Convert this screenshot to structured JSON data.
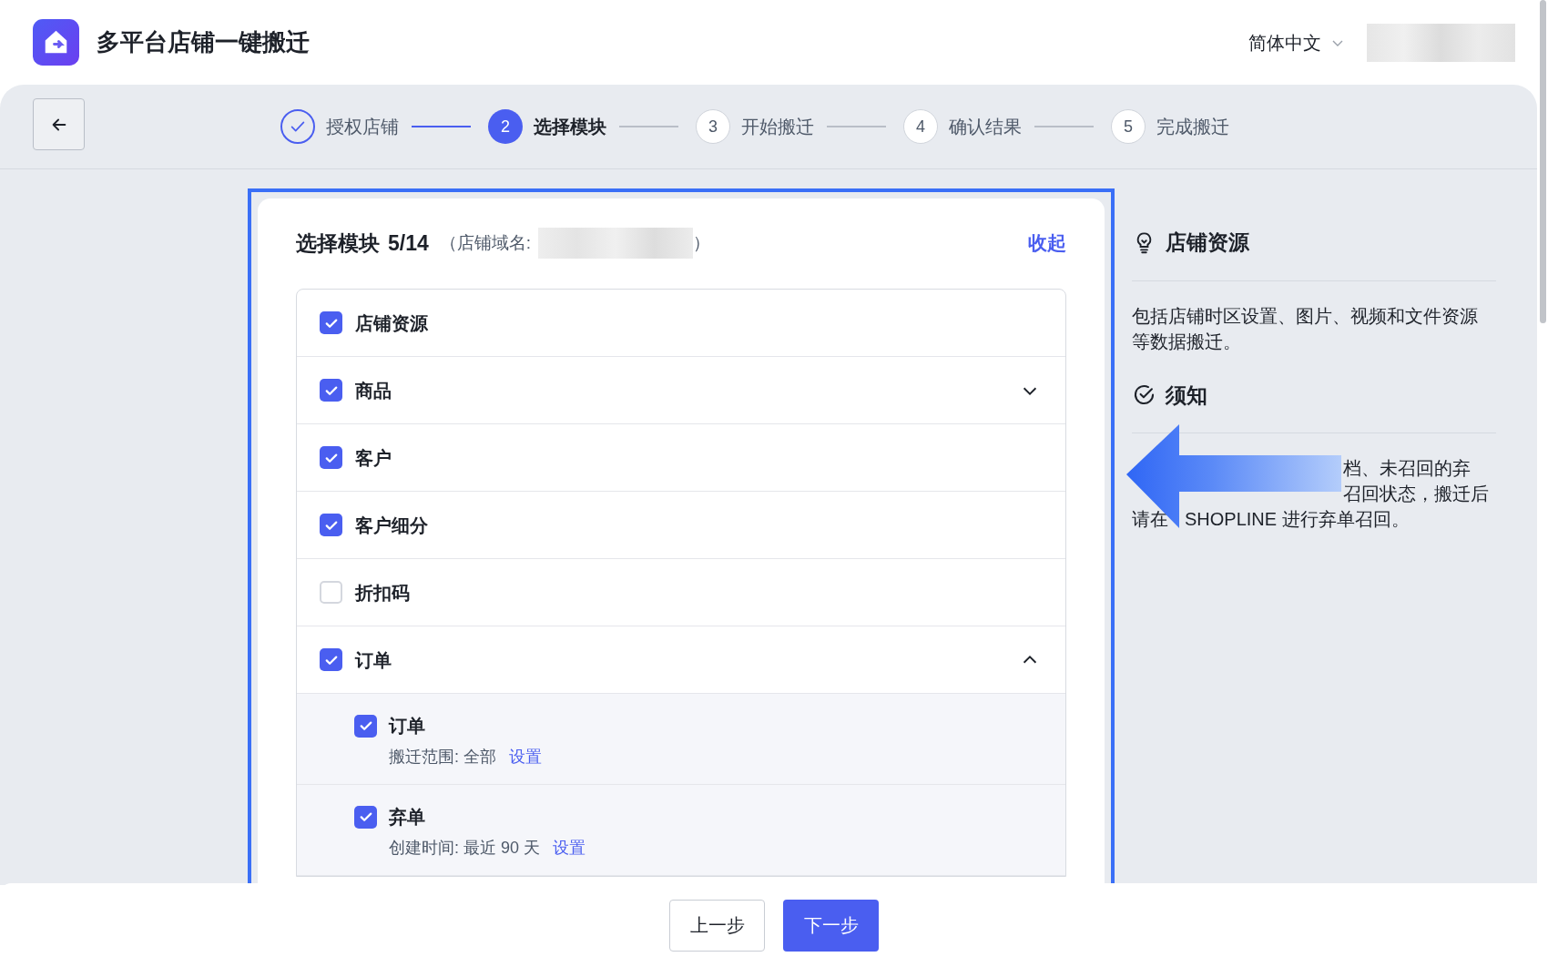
{
  "header": {
    "app_title": "多平台店铺一键搬迁",
    "language": "简体中文"
  },
  "steps": [
    {
      "label": "授权店铺",
      "completed": true,
      "selected": false
    },
    {
      "number": "2",
      "label": "选择模块",
      "completed": false,
      "selected": true
    },
    {
      "number": "3",
      "label": "开始搬迁",
      "completed": false,
      "selected": false
    },
    {
      "number": "4",
      "label": "确认结果",
      "completed": false,
      "selected": false
    },
    {
      "number": "5",
      "label": "完成搬迁",
      "completed": false,
      "selected": false
    }
  ],
  "card": {
    "title": "选择模块",
    "count": "5/14",
    "domain_prefix": "（店铺域名:",
    "domain_suffix": "）",
    "collapse_link": "收起",
    "modules": [
      {
        "kind": "plain",
        "label": "店铺资源",
        "checked": true
      },
      {
        "kind": "group",
        "label": "商品",
        "checked": true,
        "expanded": false
      },
      {
        "kind": "plain",
        "label": "客户",
        "checked": true
      },
      {
        "kind": "plain",
        "label": "客户细分",
        "checked": true
      },
      {
        "kind": "plain",
        "label": "折扣码",
        "checked": false
      },
      {
        "kind": "group",
        "label": "订单",
        "checked": true,
        "expanded": true,
        "children": [
          {
            "label": "订单",
            "checked": true,
            "detail": "搬迁范围: 全部",
            "link": "设置"
          },
          {
            "label": "弃单",
            "checked": true,
            "detail": "创建时间: 最近 90 天",
            "link": "设置"
          }
        ]
      }
    ]
  },
  "side": {
    "sections": [
      {
        "title": "店铺资源",
        "lines": [
          "包括店铺时区设置、图片、视频和文件资源",
          "等数据搬迁。"
        ]
      },
      {
        "title": "须知",
        "fragments": [
          "档、未召回的弃",
          "召回状态，搬迁后",
          "请在",
          "SHOPLINE 进行弃单召回。"
        ]
      }
    ]
  },
  "footer": {
    "buttons": [
      {
        "label": "上一步",
        "kind": "secondary"
      },
      {
        "label": "下一步",
        "kind": "primary"
      }
    ]
  }
}
